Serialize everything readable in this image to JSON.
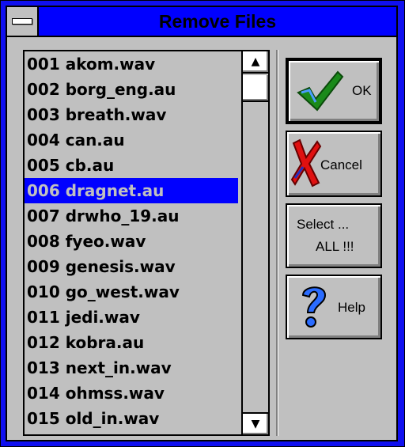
{
  "window": {
    "title": "Remove Files"
  },
  "list": {
    "items": [
      "001 akom.wav",
      "002 borg_eng.au",
      "003 breath.wav",
      "004 can.au",
      "005 cb.au",
      "006 dragnet.au",
      "007 drwho_19.au",
      "008 fyeo.wav",
      "009 genesis.wav",
      "010 go_west.wav",
      "011 jedi.wav",
      "012 kobra.au",
      "013 next_in.wav",
      "014 ohmss.wav",
      "015 old_in.wav"
    ],
    "selected": "006 dragnet.au"
  },
  "buttons": {
    "ok": "OK",
    "cancel": "Cancel",
    "select_line1": "Select ...",
    "select_line2": "ALL !!!",
    "help": "Help"
  },
  "icons": {
    "ok": "checkmark-icon",
    "cancel": "red-x-icon",
    "help": "question-mark-icon"
  },
  "colors": {
    "titlebar": "#0000ff",
    "selection": "#0000ff",
    "face": "#c0c0c0"
  }
}
